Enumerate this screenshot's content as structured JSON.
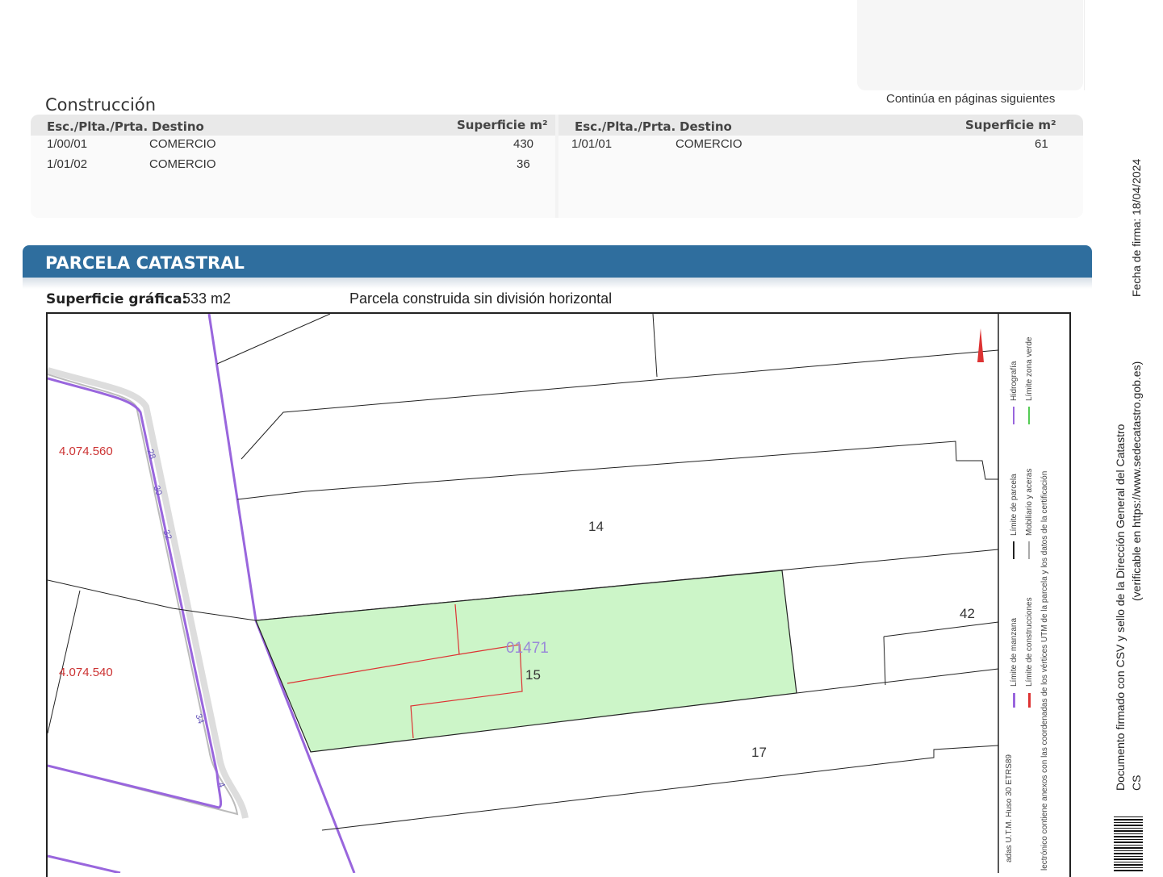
{
  "construccion": {
    "title": "Construcción",
    "continua": "Continúa en páginas siguientes",
    "headers": {
      "escalera": "Esc./Plta./Prta.",
      "destino": "Destino",
      "superficie": "Superficie m²"
    },
    "left_rows": [
      {
        "esc": "1/00/01",
        "destino": "COMERCIO",
        "superficie": "430"
      },
      {
        "esc": "1/01/02",
        "destino": "COMERCIO",
        "superficie": "36"
      }
    ],
    "right_rows": [
      {
        "esc": "1/01/01",
        "destino": "COMERCIO",
        "superficie": "61"
      }
    ]
  },
  "parcela": {
    "title": "PARCELA CATASTRAL",
    "superficie_label": "Superficie gráfica:",
    "superficie_value": "533 m2",
    "note": "Parcela construida sin división horizontal"
  },
  "map": {
    "coord_labels": [
      "4.074.560",
      "4.074.540"
    ],
    "parcel_numbers": {
      "p14": "14",
      "p15": "15",
      "p17": "17",
      "p42": "42",
      "ref": "01471"
    },
    "street_numbers": [
      "28",
      "30",
      "32",
      "34",
      "4"
    ],
    "legend": {
      "coords": "adas U.T.M. Huso 30 ETRS89",
      "items": [
        "Límite de manzana",
        "Límite de construcciones",
        "Límite de parcela",
        "Mobiliario y aceras",
        "Hidrografía",
        "Límite zona verde"
      ],
      "note": "lectrónico contiene anexos con las coordenadas de los vértices UTM de la parcela y los datos de la certificación"
    },
    "colors": {
      "parcel_fill": "#ccf5c8",
      "hydro": "#9966dd",
      "construction": "#dd3333",
      "coord_text": "#cc3333"
    }
  },
  "side_text": {
    "line1": "Documento firmado con CSV y sello de la Dirección General del Catastro",
    "line2": "CS",
    "line3": "Fecha de firma: 18/04/2024",
    "line4": "(verificable en https://www.sedecatastro.gob.es)"
  }
}
